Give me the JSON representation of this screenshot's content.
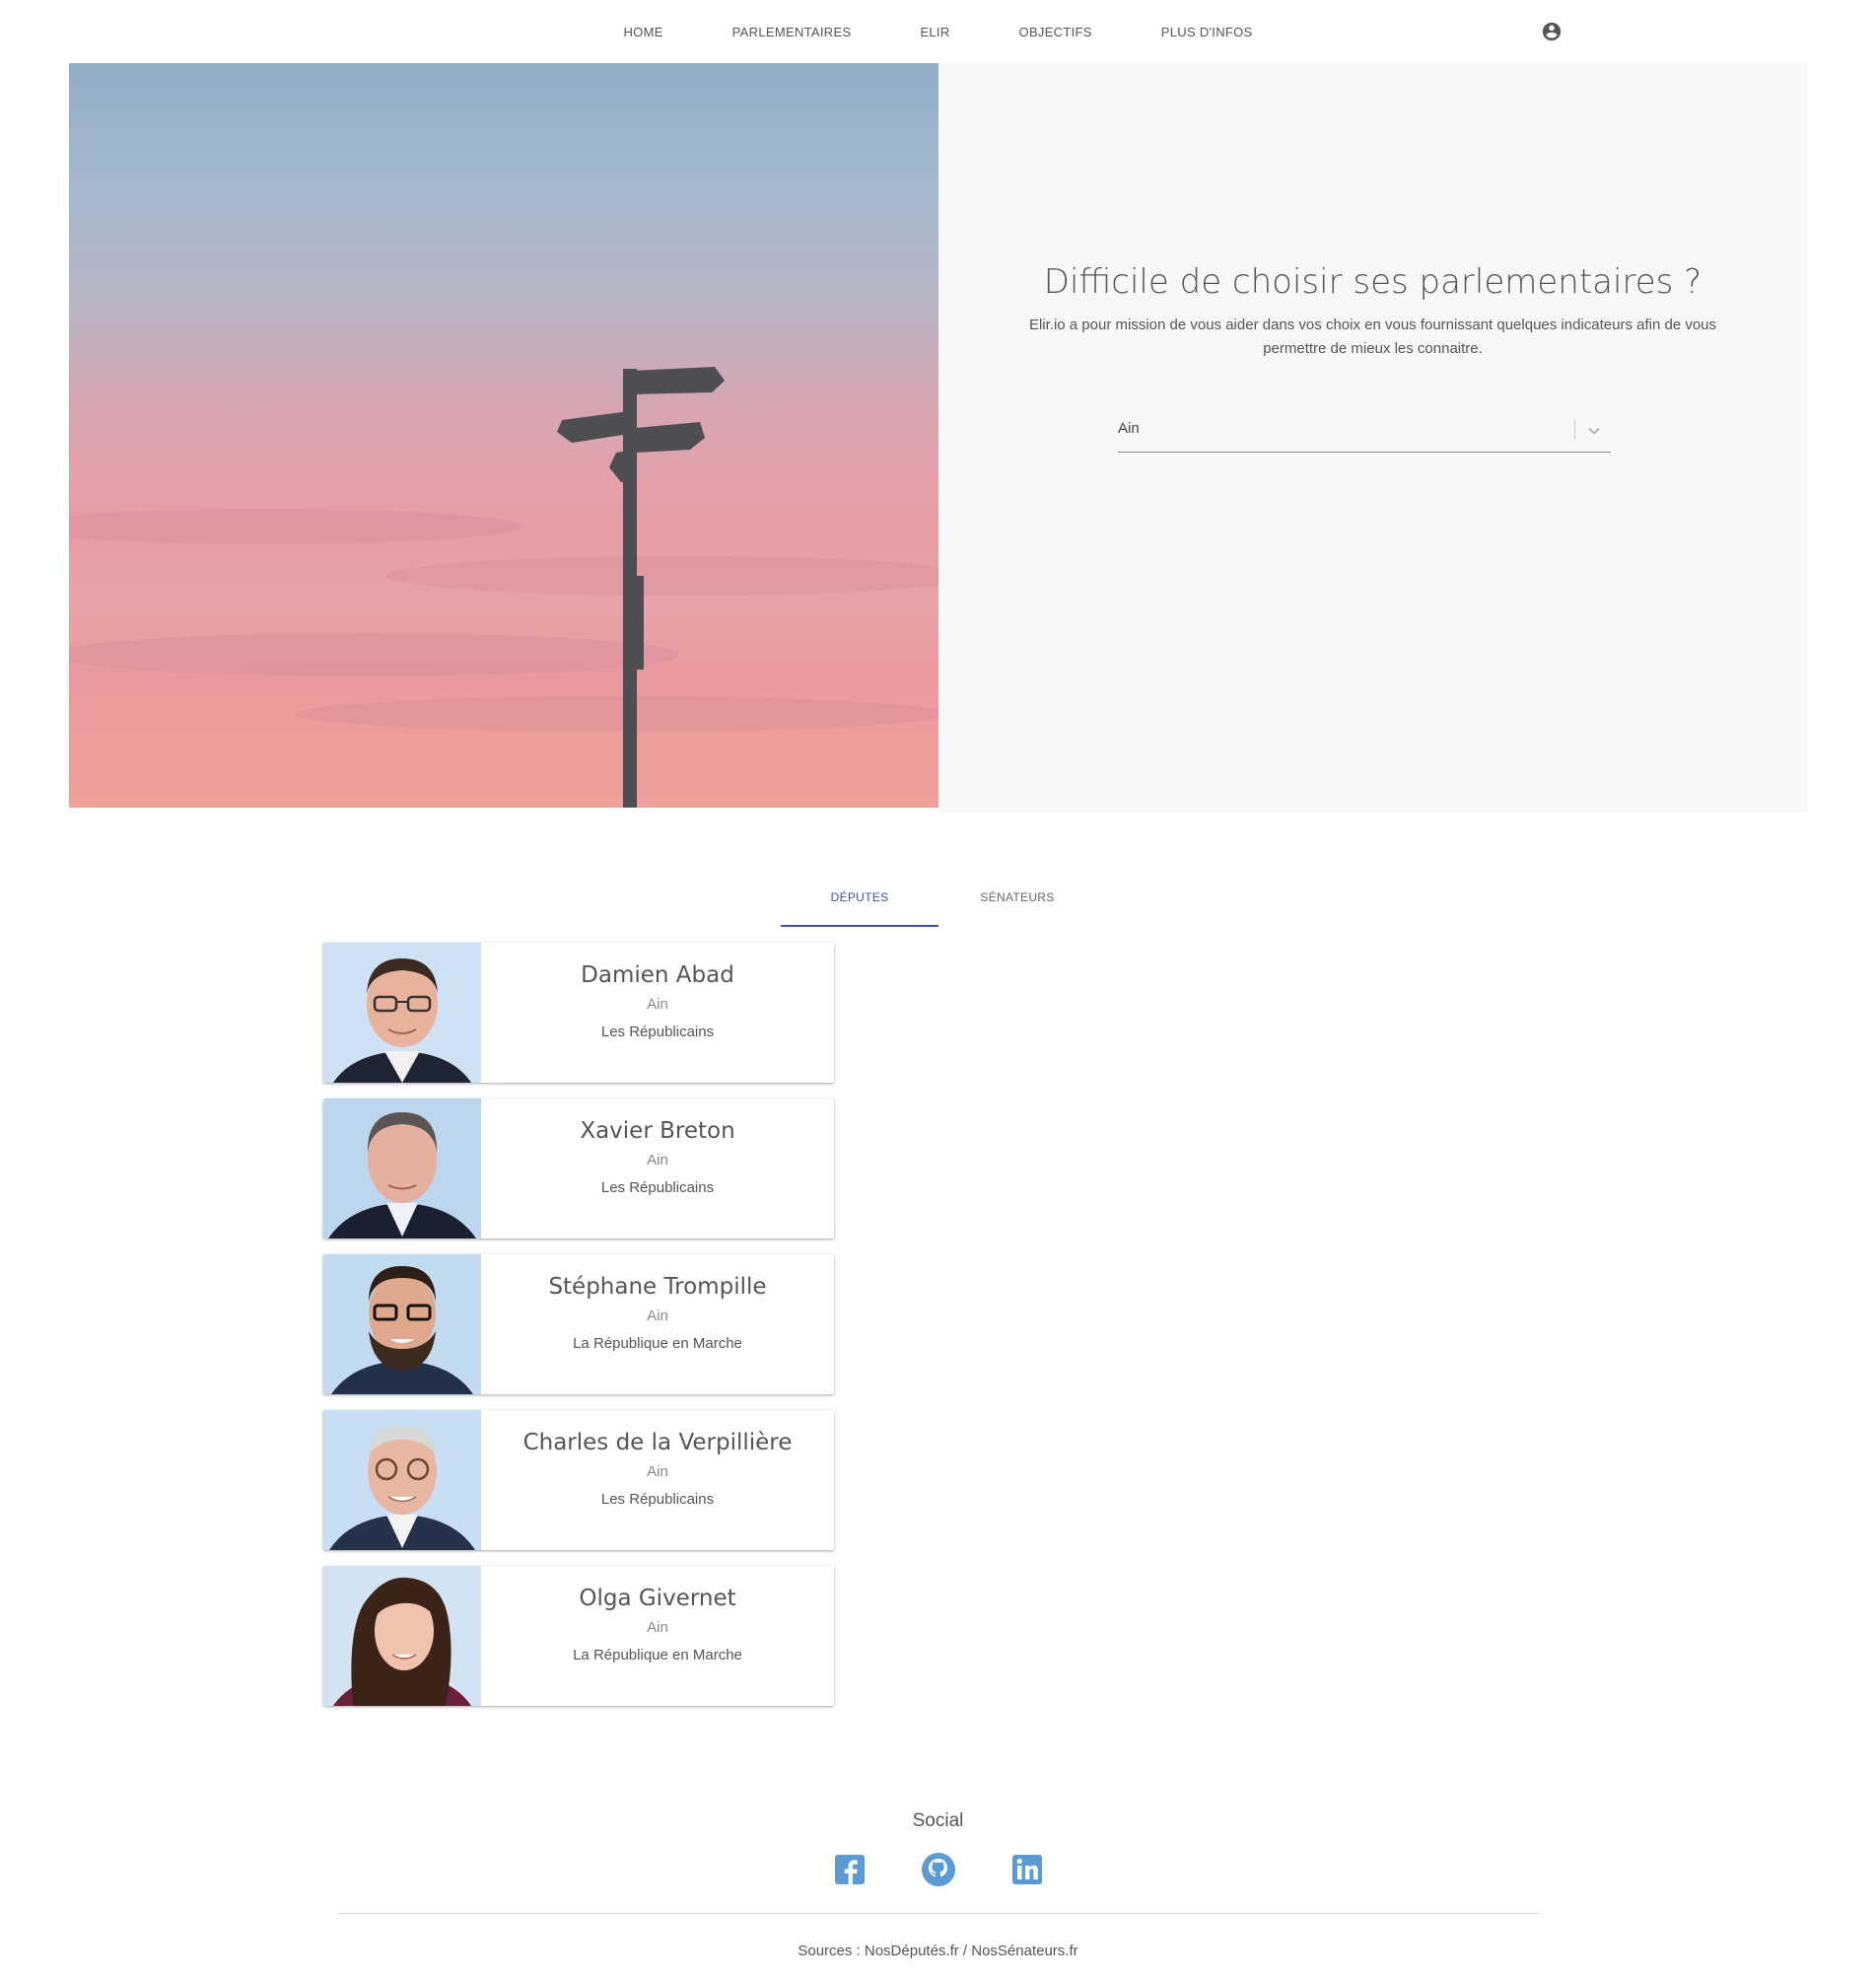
{
  "nav": {
    "links": [
      "HOME",
      "PARLEMENTAIRES",
      "ELIR",
      "OBJECTIFS",
      "PLUS D'INFOS"
    ],
    "account_icon": "account-circle-icon"
  },
  "hero": {
    "image_subject": "signpost-at-sunset",
    "title": "Difficile de choisir ses parlementaires ?",
    "description": "Elir.io a pour mission de vous aider dans vos choix en vous fournissant quelques indicateurs afin de vous permettre de mieux les connaitre.",
    "select_value": "Ain"
  },
  "tabs": [
    {
      "label": "DÉPUTES",
      "active": true
    },
    {
      "label": "SÉNATEURS",
      "active": false
    }
  ],
  "cards": [
    {
      "name": "Damien Abad",
      "dept": "Ain",
      "party": "Les Républicains"
    },
    {
      "name": "Xavier Breton",
      "dept": "Ain",
      "party": "Les Républicains"
    },
    {
      "name": "Stéphane Trompille",
      "dept": "Ain",
      "party": "La République en Marche"
    },
    {
      "name": "Charles de la Verpillière",
      "dept": "Ain",
      "party": "Les Républicains"
    },
    {
      "name": "Olga Givernet",
      "dept": "Ain",
      "party": "La République en Marche"
    }
  ],
  "footer": {
    "social_title": "Social",
    "social_icons": [
      "facebook-icon",
      "github-icon",
      "linkedin-icon"
    ],
    "sources": "Sources : NosDéputés.fr / NosSénateurs.fr",
    "icon_color": "#5b9bd5"
  },
  "colors": {
    "accent": "#3f51b5",
    "panel_bg": "#f8f8f8"
  }
}
